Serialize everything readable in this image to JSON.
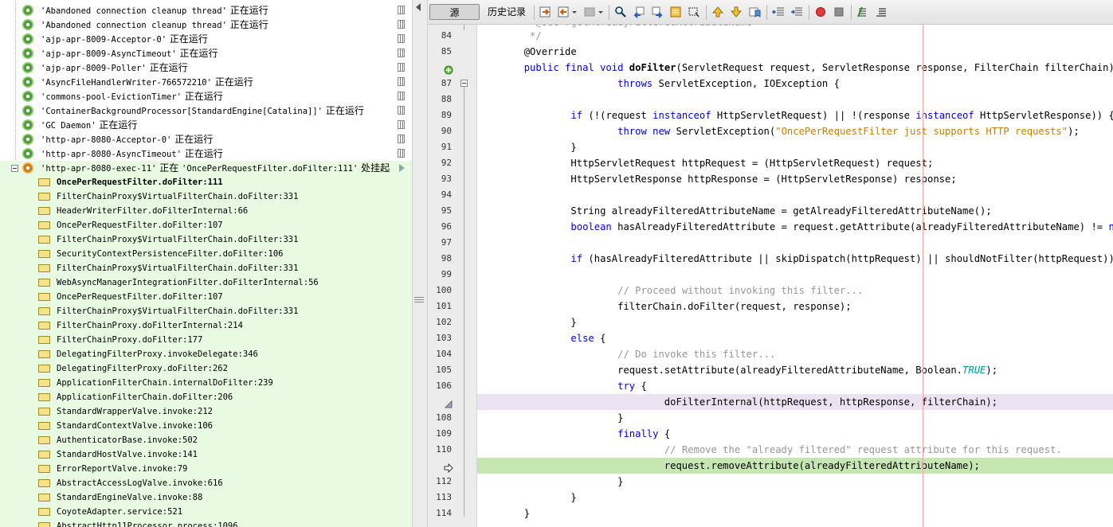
{
  "threads": [
    {
      "name": "'Abandoned connection cleanup thread'",
      "status": "正在运行"
    },
    {
      "name": "'Abandoned connection cleanup thread'",
      "status": "正在运行"
    },
    {
      "name": "'ajp-apr-8009-Acceptor-0'",
      "status": "正在运行"
    },
    {
      "name": "'ajp-apr-8009-AsyncTimeout'",
      "status": "正在运行"
    },
    {
      "name": "'ajp-apr-8009-Poller'",
      "status": "正在运行"
    },
    {
      "name": "'AsyncFileHandlerWriter-766572210'",
      "status": "正在运行"
    },
    {
      "name": "'commons-pool-EvictionTimer'",
      "status": "正在运行"
    },
    {
      "name": "'ContainerBackgroundProcessor[StandardEngine[Catalina]]'",
      "status": "正在运行"
    },
    {
      "name": "'GC Daemon'",
      "status": "正在运行"
    },
    {
      "name": "'http-apr-8080-Acceptor-0'",
      "status": "正在运行"
    },
    {
      "name": "'http-apr-8080-AsyncTimeout'",
      "status": "正在运行"
    }
  ],
  "suspended_thread": {
    "name": "'http-apr-8080-exec-11'",
    "status_prefix": "正在",
    "location": "'OncePerRequestFilter.doFilter:111'",
    "status_suffix": "处挂起"
  },
  "frames": [
    "OncePerRequestFilter.doFilter:111",
    "FilterChainProxy$VirtualFilterChain.doFilter:331",
    "HeaderWriterFilter.doFilterInternal:66",
    "OncePerRequestFilter.doFilter:107",
    "FilterChainProxy$VirtualFilterChain.doFilter:331",
    "SecurityContextPersistenceFilter.doFilter:106",
    "FilterChainProxy$VirtualFilterChain.doFilter:331",
    "WebAsyncManagerIntegrationFilter.doFilterInternal:56",
    "OncePerRequestFilter.doFilter:107",
    "FilterChainProxy$VirtualFilterChain.doFilter:331",
    "FilterChainProxy.doFilterInternal:214",
    "FilterChainProxy.doFilter:177",
    "DelegatingFilterProxy.invokeDelegate:346",
    "DelegatingFilterProxy.doFilter:262",
    "ApplicationFilterChain.internalDoFilter:239",
    "ApplicationFilterChain.doFilter:206",
    "StandardWrapperValve.invoke:212",
    "StandardContextValve.invoke:106",
    "AuthenticatorBase.invoke:502",
    "StandardHostValve.invoke:141",
    "ErrorReportValve.invoke:79",
    "AbstractAccessLogValve.invoke:616",
    "StandardEngineValve.invoke:88",
    "CoyoteAdapter.service:521",
    "AbstractHttp11Processor.process:1096"
  ],
  "toolbar": {
    "tab_source": "源",
    "tab_history": "历史记录"
  },
  "editor": {
    "partial_top_line": "        * @see #getAlreadyFilteredAttributeName",
    "line_numbers": [
      "84",
      "85",
      "",
      "87",
      "88",
      "89",
      "90",
      "91",
      "92",
      "93",
      "94",
      "95",
      "96",
      "97",
      "98",
      "99",
      "100",
      "101",
      "102",
      "103",
      "104",
      "105",
      "106",
      "",
      "108",
      "109",
      "110",
      "",
      "112",
      "113",
      "114"
    ],
    "lines": [
      [
        {
          "t": "         */",
          "c": "c"
        }
      ],
      [
        {
          "t": "        @Override"
        }
      ],
      [
        {
          "t": "        "
        },
        {
          "t": "public final void",
          "c": "k"
        },
        {
          "t": " "
        },
        {
          "t": "doFilter",
          "c": "b"
        },
        {
          "t": "(ServletRequest request, ServletResponse response, FilterChain filterChain)"
        }
      ],
      [
        {
          "t": "                        "
        },
        {
          "t": "throws",
          "c": "k"
        },
        {
          "t": " ServletException, IOException {"
        }
      ],
      [
        {
          "t": ""
        }
      ],
      [
        {
          "t": "                "
        },
        {
          "t": "if",
          "c": "k"
        },
        {
          "t": " (!(request "
        },
        {
          "t": "instanceof",
          "c": "k"
        },
        {
          "t": " HttpServletRequest) || !(response "
        },
        {
          "t": "instanceof",
          "c": "k"
        },
        {
          "t": " HttpServletResponse)) {"
        }
      ],
      [
        {
          "t": "                        "
        },
        {
          "t": "throw new",
          "c": "k"
        },
        {
          "t": " ServletException("
        },
        {
          "t": "\"OncePerRequestFilter just supports HTTP requests\"",
          "c": "s"
        },
        {
          "t": ");"
        }
      ],
      [
        {
          "t": "                }"
        }
      ],
      [
        {
          "t": "                HttpServletRequest httpRequest = (HttpServletRequest) request;"
        }
      ],
      [
        {
          "t": "                HttpServletResponse httpResponse = (HttpServletResponse) response;"
        }
      ],
      [
        {
          "t": ""
        }
      ],
      [
        {
          "t": "                String alreadyFilteredAttributeName = getAlreadyFilteredAttributeName();"
        }
      ],
      [
        {
          "t": "                "
        },
        {
          "t": "boolean",
          "c": "k"
        },
        {
          "t": " hasAlreadyFilteredAttribute = request.getAttribute(alreadyFilteredAttributeName) != "
        },
        {
          "t": "null",
          "c": "k"
        },
        {
          "t": ";"
        }
      ],
      [
        {
          "t": ""
        }
      ],
      [
        {
          "t": "                "
        },
        {
          "t": "if",
          "c": "k"
        },
        {
          "t": " (hasAlreadyFilteredAttribute || skipDispatch(httpRequest) || shouldNotFilter(httpRequest)) {"
        }
      ],
      [
        {
          "t": ""
        }
      ],
      [
        {
          "t": "                        "
        },
        {
          "t": "// Proceed without invoking this filter...",
          "c": "c"
        }
      ],
      [
        {
          "t": "                        filterChain.doFilter(request, response);"
        }
      ],
      [
        {
          "t": "                }"
        }
      ],
      [
        {
          "t": "                "
        },
        {
          "t": "else",
          "c": "k"
        },
        {
          "t": " {"
        }
      ],
      [
        {
          "t": "                        "
        },
        {
          "t": "// Do invoke this filter...",
          "c": "c"
        }
      ],
      [
        {
          "t": "                        request.setAttribute(alreadyFilteredAttributeName, Boolean."
        },
        {
          "t": "TRUE",
          "c": "i"
        },
        {
          "t": ");"
        }
      ],
      [
        {
          "t": "                        "
        },
        {
          "t": "try",
          "c": "k"
        },
        {
          "t": " {"
        }
      ],
      [
        {
          "t": "                                doFilterInternal(httpRequest, httpResponse, filterChain);"
        }
      ],
      [
        {
          "t": "                        }"
        }
      ],
      [
        {
          "t": "                        "
        },
        {
          "t": "finally",
          "c": "k"
        },
        {
          "t": " {"
        }
      ],
      [
        {
          "t": "                                "
        },
        {
          "t": "// Remove the \"already filtered\" request attribute for this request.",
          "c": "c"
        }
      ],
      [
        {
          "t": "                                request.removeAttribute(alreadyFilteredAttributeName);"
        }
      ],
      [
        {
          "t": "                        }"
        }
      ],
      [
        {
          "t": "                }"
        }
      ],
      [
        {
          "t": "        }"
        }
      ]
    ],
    "breakpoint_line_index": 23,
    "current_line_index": 27
  },
  "colors": {
    "keyword": "#0000e6",
    "comment": "#969696",
    "string": "#ce7b00",
    "current_line": "#c6e6b2",
    "breakpoint_line": "#ece3f2",
    "margin_line": "#f3a4a4",
    "suspended_bg": "#e8fbe2"
  },
  "icons": [
    "source-tab",
    "history-tab",
    "back-icon",
    "forward-icon",
    "find-icon",
    "find-prev-icon",
    "find-next-icon",
    "toggle-highlight-icon",
    "toggle-rect-icon",
    "prev-bookmark-icon",
    "next-bookmark-icon",
    "toggle-bookmark-icon",
    "shift-left-icon",
    "shift-right-icon",
    "start-macro-icon",
    "stop-macro-icon",
    "comment-icon",
    "uncomment-icon"
  ]
}
